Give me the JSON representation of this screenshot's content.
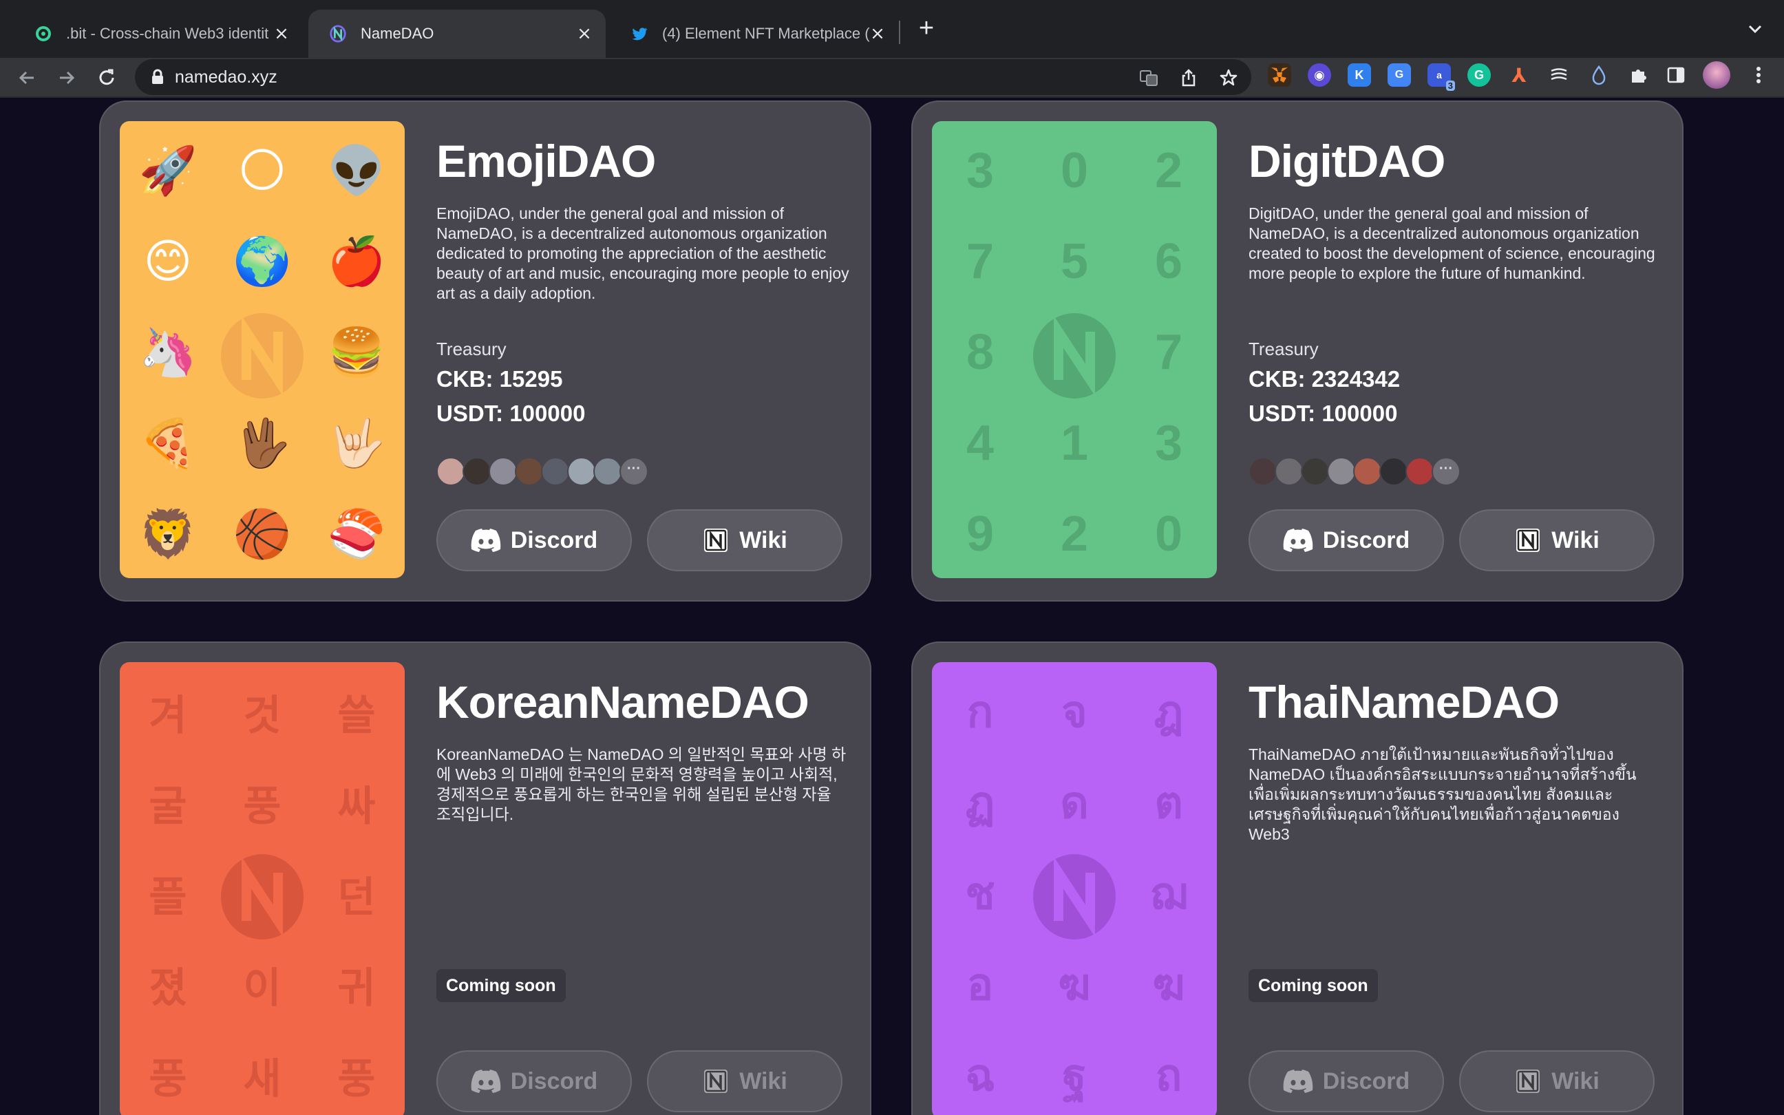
{
  "browser": {
    "tabs": [
      {
        "title": ".bit - Cross-chain Web3 identit",
        "icon": "dotbit-icon"
      },
      {
        "title": "NameDAO",
        "icon": "namedao-icon"
      },
      {
        "title": "(4) Element NFT Marketplace (",
        "icon": "twitter-icon"
      }
    ],
    "new_tab": "+",
    "close_glyph": "×",
    "url": "namedao.xyz",
    "extensions_badge": "3"
  },
  "colors": {
    "page_bg": "#0e0c1e",
    "card_bg": "#47464f",
    "emoji_art": "#fdbb55",
    "digit_art": "#64c488",
    "korean_art": "#f36749",
    "thai_art": "#b962f6"
  },
  "cards": [
    {
      "name": "EmojiDAO",
      "description": "EmojiDAO, under the general goal and mission of NameDAO, is a decentralized autonomous organization dedicated to promoting the appreciation of the aesthetic beauty of art and music, encouraging more people to enjoy art as a daily adoption.",
      "treasury_label": "Treasury",
      "ckb": "CKB: 15295",
      "usdt": "USDT: 100000",
      "grid": [
        "🚀",
        "🌕",
        "👽",
        "😊",
        "🌍",
        "🍎",
        "🦄",
        "",
        "🍔",
        "🍕",
        "🖖🏾",
        "🤟🏻",
        "🦁",
        "🏀",
        "🍣"
      ],
      "more": "···",
      "discord_label": "Discord",
      "wiki_label": "Wiki"
    },
    {
      "name": "DigitDAO",
      "description": "DigitDAO, under the general goal and mission of NameDAO, is a decentralized autonomous organization created to boost the development of science, encouraging more people to explore the future of humankind.",
      "treasury_label": "Treasury",
      "ckb": "CKB: 2324342",
      "usdt": "USDT: 100000",
      "grid": [
        "3",
        "0",
        "2",
        "7",
        "5",
        "6",
        "8",
        "",
        "7",
        "4",
        "1",
        "3",
        "9",
        "2",
        "0"
      ],
      "more": "···",
      "discord_label": "Discord",
      "wiki_label": "Wiki"
    },
    {
      "name": "KoreanNameDAO",
      "description": "KoreanNameDAO 는 NameDAO 의 일반적인 목표와 사명 하에 Web3 의 미래에 한국인의 문화적 영향력을 높이고 사회적, 경제적으로 풍요롭게 하는 한국인을 위해 설립된 분산형 자율 조직입니다.",
      "status": "Coming soon",
      "grid": [
        "겨",
        "것",
        "쓸",
        "굴",
        "풍",
        "싸",
        "플",
        "",
        "던",
        "졌",
        "이",
        "귀",
        "풍",
        "새",
        "풍"
      ],
      "discord_label": "Discord",
      "wiki_label": "Wiki"
    },
    {
      "name": "ThaiNameDAO",
      "description": "ThaiNameDAO ภายใต้เป้าหมายและพันธกิจทั่วไปของ NameDAO เป็นองค์กรอิสระแบบกระจายอำนาจที่สร้างขึ้นเพื่อเพิ่มผลกระทบทางวัฒนธรรมของคนไทย สังคมและเศรษฐกิจที่เพิ่มคุณค่าให้กับคนไทยเพื่อก้าวสู่อนาคตของ Web3",
      "status": "Coming soon",
      "grid": [
        "ก",
        "จ",
        "ฎ",
        "ฏ",
        "ด",
        "ต",
        "ช",
        "",
        "ฌ",
        "อ",
        "ฆ",
        "ฆ",
        "ฉ",
        "ฐ",
        "ถ"
      ],
      "discord_label": "Discord",
      "wiki_label": "Wiki"
    }
  ]
}
